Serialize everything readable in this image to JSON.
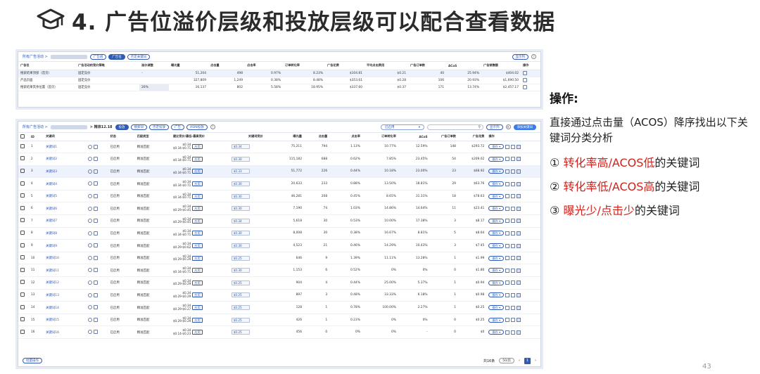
{
  "slide": {
    "title": "4. 广告位溢价层级和投放层级可以配合查看数据",
    "page_number": "43"
  },
  "top_panel": {
    "breadcrumb": "所有广告活动 >",
    "tabs": [
      "广告组",
      "广告位",
      "否定关键词"
    ],
    "active_tab_index": 1,
    "right_button": "显示列",
    "columns": [
      "广告位",
      "广告活动的竞价策略",
      "溢价调整",
      "曝光量",
      "点击量",
      "点击率",
      "订单转化率",
      "广告花费",
      "平均点击费用",
      "广告订单数",
      "ACoS",
      "广告销售额",
      "操作"
    ],
    "rows": [
      [
        "搜索结果顶部（首页）",
        "固定竞价",
        "-",
        "51,204",
        "498",
        "0.97%",
        "8.23%",
        "$104.81",
        "$0.21",
        "40",
        "25.94%",
        "$404.02"
      ],
      [
        "产品页面",
        "固定竞价",
        "",
        "327,809",
        "1,249",
        "0.38%",
        "8.48%",
        "$353.61",
        "$0.28",
        "106",
        "20.93%",
        "$1,690.50"
      ],
      [
        "搜索结果其余位置（首页）",
        "固定竞价",
        "20%",
        "16,137",
        "802",
        "5.58%",
        "18.95%",
        "$337.60",
        "$0.37",
        "171",
        "13.74%",
        "$2,457.17"
      ]
    ]
  },
  "bottom_panel": {
    "breadcrumb": "所有广告活动 >",
    "group_suffix": "> 精准12.18",
    "tabs": [
      "投放",
      "搜索词",
      "否定投放",
      "广告",
      "ASIN投放"
    ],
    "active_tab_index": 0,
    "status_select": "已启用",
    "search_placeholder": "",
    "show_columns_button": "显示列",
    "add_keyword_button": "添加关键词",
    "columns": [
      "ID",
      "关键词",
      "",
      "状态",
      "匹配类型",
      "建议竞价/最低-最高竞价",
      "关键词竞价",
      "曝光量",
      "点击量",
      "点击率",
      "订单转化率",
      "ACoS",
      "广告订单数",
      "广告花费",
      "操作"
    ],
    "rows": [
      {
        "id": "1",
        "keyword": "关键词1",
        "status": "已启用",
        "match": "精准匹配",
        "sug": "$0.34",
        "range": "$0.34-$0.71",
        "bid": "$0.34",
        "impr": "75,211",
        "clicks": "794",
        "ctr": "1.13%",
        "cvr": "10.77%",
        "acos": "12.59%",
        "orders": "148",
        "spend": "$293.72"
      },
      {
        "id": "2",
        "keyword": "关键词2",
        "status": "已启用",
        "match": "精准匹配",
        "sug": "$0.34",
        "range": "$0.34-$0.71",
        "bid": "$0.30",
        "impr": "115,182",
        "clicks": "688",
        "ctr": "0.62%",
        "cvr": "7.85%",
        "acos": "23.45%",
        "orders": "54",
        "spend": "$209.02"
      },
      {
        "id": "3",
        "keyword": "关键词3",
        "status": "已启用",
        "match": "精准匹配",
        "sug": "$0.34",
        "range": "$0.34-$0.71",
        "bid": "$0.33",
        "impr": "51,772",
        "clicks": "226",
        "ctr": "0.44%",
        "cvr": "10.18%",
        "acos": "23.00%",
        "orders": "23",
        "spend": "$68.92"
      },
      {
        "id": "4",
        "keyword": "关键词4",
        "status": "已启用",
        "match": "精准匹配",
        "sug": "$0.34",
        "range": "$0.34-$0.71",
        "bid": "$0.30",
        "impr": "20,633",
        "clicks": "233",
        "ctr": "0.88%",
        "cvr": "13.50%",
        "acos": "18.81%",
        "orders": "29",
        "spend": "$63.76"
      },
      {
        "id": "5",
        "keyword": "关键词5",
        "status": "已启用",
        "match": "精准匹配",
        "sug": "$0.34",
        "range": "$0.34-$0.71",
        "bid": "$0.30",
        "impr": "46,281",
        "clicks": "208",
        "ctr": "0.45%",
        "cvr": "8.65%",
        "acos": "31.31%",
        "orders": "18",
        "spend": "$78.63"
      },
      {
        "id": "6",
        "keyword": "关键词6",
        "status": "已启用",
        "match": "精准匹配",
        "sug": "$0.34",
        "range": "$0.29-$0.45",
        "bid": "$0.30",
        "impr": "7,190",
        "clicks": "74",
        "ctr": "1.03%",
        "cvr": "14.86%",
        "acos": "14.64%",
        "orders": "11",
        "spend": "$23.41"
      },
      {
        "id": "7",
        "keyword": "关键词7",
        "status": "已启用",
        "match": "精准匹配",
        "sug": "$0.34",
        "range": "$0.29-$0.45",
        "bid": "$0.34",
        "impr": "5,618",
        "clicks": "30",
        "ctr": "0.53%",
        "cvr": "10.00%",
        "acos": "17.38%",
        "orders": "3",
        "spend": "$8.17"
      },
      {
        "id": "8",
        "keyword": "关键词8",
        "status": "已启用",
        "match": "精准匹配",
        "sug": "$0.34",
        "range": "$0.34-$0.71",
        "bid": "$0.30",
        "impr": "8,008",
        "clicks": "30",
        "ctr": "0.38%",
        "cvr": "16.67%",
        "acos": "8.81%",
        "orders": "5",
        "spend": "$8.64"
      },
      {
        "id": "9",
        "keyword": "关键词9",
        "status": "已启用",
        "match": "精准匹配",
        "sug": "$0.34",
        "range": "$0.29-$0.62",
        "bid": "$0.30",
        "impr": "4,523",
        "clicks": "21",
        "ctr": "0.46%",
        "cvr": "14.29%",
        "acos": "10.43%",
        "orders": "3",
        "spend": "$7.45"
      },
      {
        "id": "10",
        "keyword": "关键词10",
        "status": "已启用",
        "match": "精准匹配",
        "sug": "$0.34",
        "range": "$0.29-$0.29",
        "bid": "$0.25",
        "impr": "646",
        "clicks": "9",
        "ctr": "1.39%",
        "cvr": "11.11%",
        "acos": "13.28%",
        "orders": "1",
        "spend": "$1.99"
      },
      {
        "id": "11",
        "keyword": "关键词11",
        "status": "已启用",
        "match": "精准匹配",
        "sug": "$0.34",
        "range": "$0.34-$0.71",
        "bid": "$0.30",
        "impr": "1,153",
        "clicks": "6",
        "ctr": "0.52%",
        "cvr": "0%",
        "acos": "0%",
        "orders": "0",
        "spend": "$1.80"
      },
      {
        "id": "12",
        "keyword": "关键词12",
        "status": "已启用",
        "match": "精准匹配",
        "sug": "$0.34",
        "range": "$0.29-$0.29",
        "bid": "$0.25",
        "impr": "904",
        "clicks": "4",
        "ctr": "0.44%",
        "cvr": "25.00%",
        "acos": "5.37%",
        "orders": "1",
        "spend": "$0.94"
      },
      {
        "id": "13",
        "keyword": "关键词13",
        "status": "已启用",
        "match": "精准匹配",
        "sug": "$0.34",
        "range": "$0.29-$0.29",
        "bid": "$0.25",
        "impr": "897",
        "clicks": "3",
        "ctr": "0.48%",
        "cvr": "33.33%",
        "acos": "6.18%",
        "orders": "1",
        "spend": "$0.98"
      },
      {
        "id": "14",
        "keyword": "关键词14",
        "status": "已启用",
        "match": "精准匹配",
        "sug": "$0.34",
        "range": "$0.29-$0.27",
        "bid": "$0.25",
        "impr": "128",
        "clicks": "1",
        "ctr": "0.78%",
        "cvr": "100.00%",
        "acos": "2.27%",
        "orders": "1",
        "spend": "$0.25"
      },
      {
        "id": "15",
        "keyword": "关键词15",
        "status": "已启用",
        "match": "精准匹配",
        "sug": "$0.34",
        "range": "$0.29-$0.29",
        "bid": "$0.25",
        "impr": "426",
        "clicks": "1",
        "ctr": "0.23%",
        "cvr": "0%",
        "acos": "0%",
        "orders": "0",
        "spend": "$0.25"
      },
      {
        "id": "16",
        "keyword": "关键词16",
        "status": "已启用",
        "match": "精准匹配",
        "sug": "$0.34",
        "range": "$0.14-$0.23",
        "bid": "$0.25",
        "impr": "456",
        "clicks": "0",
        "ctr": "0%",
        "cvr": "0%",
        "acos": "-",
        "orders": "0",
        "spend": "$0"
      }
    ],
    "apply_label": "应用",
    "op_label": "操作",
    "footer_left": "批量操作",
    "footer_total": "共16条",
    "footer_per_page": "50/页",
    "footer_page": "1"
  },
  "panel": {
    "title": "操作:",
    "desc": "直接通过点击量（ACOS）降序找出以下关键词分类分析",
    "items": [
      {
        "num": "①",
        "red": "转化率高/ACOS低",
        "rest": "的关键词"
      },
      {
        "num": "②",
        "red": "转化率低/ACOS高",
        "rest": "的关键词"
      },
      {
        "num": "③",
        "red": "曝光少/点击少",
        "rest": "的关键词"
      }
    ]
  },
  "colors": {
    "accent": "#2f5bb7",
    "highlight_red": "#d0231c"
  }
}
